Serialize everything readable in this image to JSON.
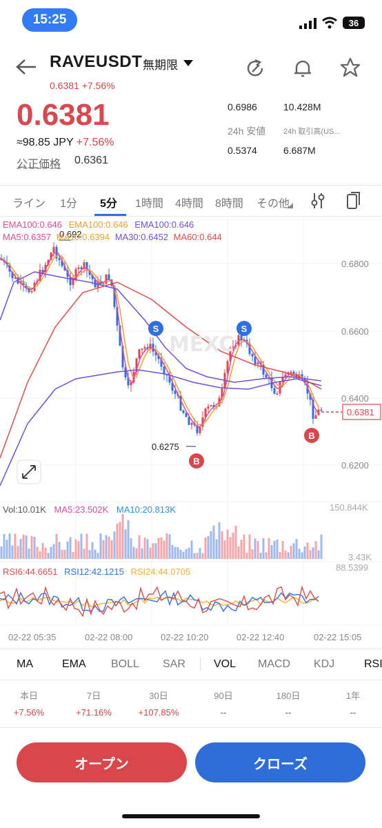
{
  "status_bar": {
    "time": "15:25",
    "battery": "36"
  },
  "header": {
    "symbol": "RAVEUSDT",
    "contract_type": "無期限",
    "sub_price": "0.6381 +7.56%",
    "price": "0.6381",
    "jpy": "≈98.85 JPY",
    "jpy_change": "+7.56%",
    "fair_price_label": "公正価格",
    "fair_price": "0.6361",
    "stats": {
      "high_value": "0.6986",
      "volume_value": "10.428M",
      "low_label": "24h 安値",
      "turnover_label": "24h 取引高(US...",
      "low_value": "0.5374",
      "turnover_value": "6.687M"
    }
  },
  "timeframe_tabs": [
    "ライン",
    "1分",
    "5分",
    "1時間",
    "4時間",
    "8時間",
    "その他"
  ],
  "active_timeframe": "5分",
  "chart": {
    "ema_legend": [
      "EMA100:0.646",
      "EMA100:0.646",
      "EMA100:0.646"
    ],
    "ma_legend": [
      "MA5:0.6357",
      "MA10:0.6394",
      "MA30:0.6452",
      "MA60:0.644"
    ],
    "price_axis": [
      "0.6800",
      "0.6600",
      "0.6400",
      "0.6200"
    ],
    "current_price_tag": "0.6381",
    "high_marker": "0.692",
    "low_marker": "0.6275",
    "sell_marker": "S",
    "buy_marker": "B",
    "watermark": "MEXC",
    "vol_legend": {
      "vol": "Vol:10.01K",
      "ma5": "MA5:23.502K",
      "ma10": "MA10:20.813K"
    },
    "vol_axis": [
      "150.844K",
      "3.43K"
    ],
    "rsi_legend": {
      "rsi6": "RSI6:44.6651",
      "rsi12": "RSI12:42.1215",
      "rsi24": "RSI24:44.0705"
    },
    "rsi_axis": "88.5399",
    "time_axis": [
      "02-22 05:35",
      "02-22 08:00",
      "02-22 10:20",
      "02-22 12:40",
      "02-22 15:05"
    ],
    "colors": {
      "up": "#e0454f",
      "down": "#2f6fe0",
      "ema": "#f0a030",
      "ma30": "#6c4fe0",
      "ma60": "#e04a4a"
    }
  },
  "indicator_tabs": [
    "MA",
    "EMA",
    "BOLL",
    "SAR",
    "VOL",
    "MACD",
    "KDJ",
    "RSI"
  ],
  "performance": [
    {
      "label": "本日",
      "value": "+7.56%"
    },
    {
      "label": "7日",
      "value": "+71.16%"
    },
    {
      "label": "30日",
      "value": "+107.85%"
    },
    {
      "label": "90日",
      "value": "--"
    },
    {
      "label": "180日",
      "value": "--"
    },
    {
      "label": "1年",
      "value": "--"
    }
  ],
  "actions": {
    "open": "オープン",
    "close": "クローズ"
  }
}
